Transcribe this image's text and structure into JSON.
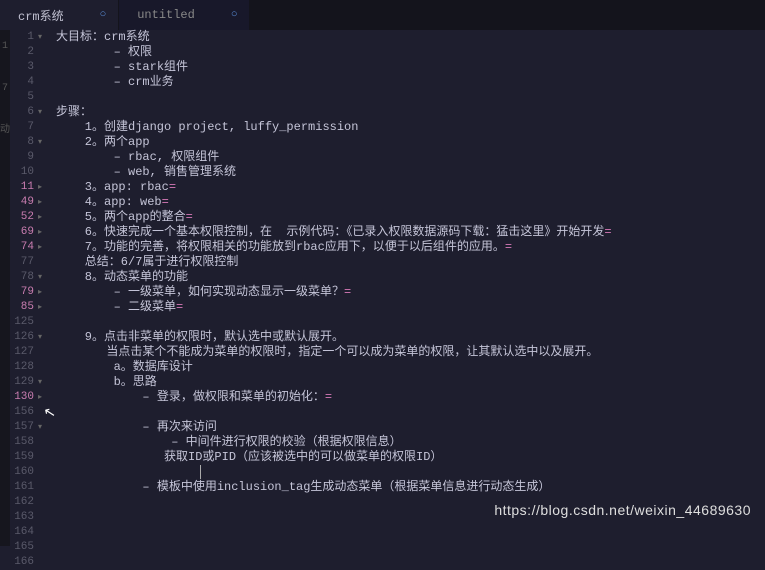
{
  "tabs": [
    {
      "label": "crm系统",
      "active": true
    },
    {
      "label": "untitled",
      "active": false
    }
  ],
  "sidebar_markers": [
    "1",
    "",
    "",
    "7",
    "",
    "",
    "动"
  ],
  "lines": [
    {
      "num": "1",
      "fold": "▾",
      "changed": false,
      "text": "大目标：crm系统"
    },
    {
      "num": "2",
      "fold": "",
      "changed": false,
      "text": "        – 权限"
    },
    {
      "num": "3",
      "fold": "",
      "changed": false,
      "text": "        – stark组件"
    },
    {
      "num": "4",
      "fold": "",
      "changed": false,
      "text": "        – crm业务"
    },
    {
      "num": "5",
      "fold": "",
      "changed": false,
      "text": ""
    },
    {
      "num": "6",
      "fold": "▾",
      "changed": false,
      "text": "步骤："
    },
    {
      "num": "7",
      "fold": "",
      "changed": false,
      "text": "    1。创建django project, luffy_permission"
    },
    {
      "num": "8",
      "fold": "▾",
      "changed": false,
      "text": "    2。两个app"
    },
    {
      "num": "9",
      "fold": "",
      "changed": false,
      "text": "        – rbac, 权限组件"
    },
    {
      "num": "10",
      "fold": "",
      "changed": false,
      "text": "        – web, 销售管理系统"
    },
    {
      "num": "11",
      "fold": "▸",
      "changed": true,
      "text": "    3。app: rbac",
      "trail": "="
    },
    {
      "num": "49",
      "fold": "▸",
      "changed": true,
      "text": "    4。app: web",
      "trail": "="
    },
    {
      "num": "52",
      "fold": "▸",
      "changed": true,
      "text": "    5。两个app的整合",
      "trail": "="
    },
    {
      "num": "69",
      "fold": "▸",
      "changed": true,
      "text": "    6。快速完成一个基本权限控制，在  示例代码：《已录入权限数据源码下载：猛击这里》开始开发",
      "trail": "="
    },
    {
      "num": "74",
      "fold": "▸",
      "changed": true,
      "text": "    7。功能的完善，将权限相关的功能放到rbac应用下，以便于以后组件的应用。",
      "trail": "="
    },
    {
      "num": "77",
      "fold": "",
      "changed": false,
      "text": "    总结：6/7属于进行权限控制"
    },
    {
      "num": "78",
      "fold": "▾",
      "changed": false,
      "text": "    8。动态菜单的功能"
    },
    {
      "num": "79",
      "fold": "▸",
      "changed": true,
      "text": "        – 一级菜单，如何实现动态显示一级菜单？",
      "trail": "="
    },
    {
      "num": "85",
      "fold": "▸",
      "changed": true,
      "text": "        – 二级菜单",
      "trail": "="
    },
    {
      "num": "125",
      "fold": "",
      "changed": false,
      "text": ""
    },
    {
      "num": "126",
      "fold": "▾",
      "changed": false,
      "text": "    9。点击非菜单的权限时，默认选中或默认展开。"
    },
    {
      "num": "127",
      "fold": "",
      "changed": false,
      "text": "       当点击某个不能成为菜单的权限时，指定一个可以成为菜单的权限，让其默认选中以及展开。"
    },
    {
      "num": "128",
      "fold": "",
      "changed": false,
      "text": "        a。数据库设计"
    },
    {
      "num": "129",
      "fold": "▾",
      "changed": false,
      "text": "        b。思路"
    },
    {
      "num": "130",
      "fold": "▸",
      "changed": true,
      "text": "            – 登录，做权限和菜单的初始化：",
      "trail": "="
    },
    {
      "num": "156",
      "fold": "",
      "changed": false,
      "text": ""
    },
    {
      "num": "157",
      "fold": "▾",
      "changed": false,
      "text": "            – 再次来访问"
    },
    {
      "num": "158",
      "fold": "",
      "changed": false,
      "text": "                – 中间件进行权限的校验（根据权限信息）"
    },
    {
      "num": "159",
      "fold": "",
      "changed": false,
      "text": "               获取ID或PID（应该被选中的可以做菜单的权限ID）"
    },
    {
      "num": "160",
      "fold": "",
      "changed": false,
      "text": "",
      "cursor": true
    },
    {
      "num": "161",
      "fold": "",
      "changed": false,
      "text": "            – 模板中使用inclusion_tag生成动态菜单（根据菜单信息进行动态生成）"
    },
    {
      "num": "162",
      "fold": "",
      "changed": false,
      "text": ""
    },
    {
      "num": "163",
      "fold": "",
      "changed": false,
      "text": ""
    },
    {
      "num": "164",
      "fold": "",
      "changed": false,
      "text": ""
    },
    {
      "num": "165",
      "fold": "",
      "changed": false,
      "text": ""
    },
    {
      "num": "166",
      "fold": "",
      "changed": false,
      "text": ""
    }
  ],
  "watermark": "https://blog.csdn.net/weixin_44689630"
}
